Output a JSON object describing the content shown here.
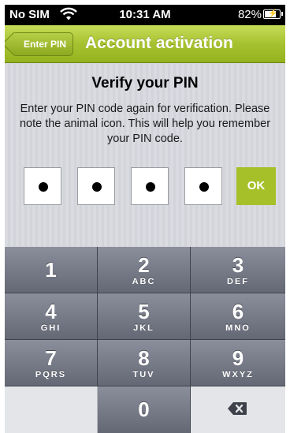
{
  "status_bar": {
    "carrier": "No SIM",
    "wifi_icon": "wifi-icon",
    "time": "10:31 AM",
    "battery_percent": "82%",
    "battery_icon": "battery-charging-icon",
    "battery_level": 0.82
  },
  "nav_bar": {
    "back_label": "Enter PIN",
    "title": "Account activation",
    "color": "#a7c230"
  },
  "verify": {
    "heading": "Verify your PIN",
    "instructions": "Enter your PIN code again for verification. Please note the animal icon. This will help you remember your PIN code.",
    "pin_slots": [
      "●",
      "●",
      "●",
      "●"
    ],
    "ok_label": "OK",
    "ok_color": "#a6c02a"
  },
  "keypad": {
    "keys": [
      {
        "digit": "1",
        "letters": ""
      },
      {
        "digit": "2",
        "letters": "ABC"
      },
      {
        "digit": "3",
        "letters": "DEF"
      },
      {
        "digit": "4",
        "letters": "GHI"
      },
      {
        "digit": "5",
        "letters": "JKL"
      },
      {
        "digit": "6",
        "letters": "MNO"
      },
      {
        "digit": "7",
        "letters": "PQRS"
      },
      {
        "digit": "8",
        "letters": "TUV"
      },
      {
        "digit": "9",
        "letters": "WXYZ"
      },
      {
        "digit": "0",
        "letters": ""
      }
    ],
    "delete_icon": "backspace-icon"
  }
}
